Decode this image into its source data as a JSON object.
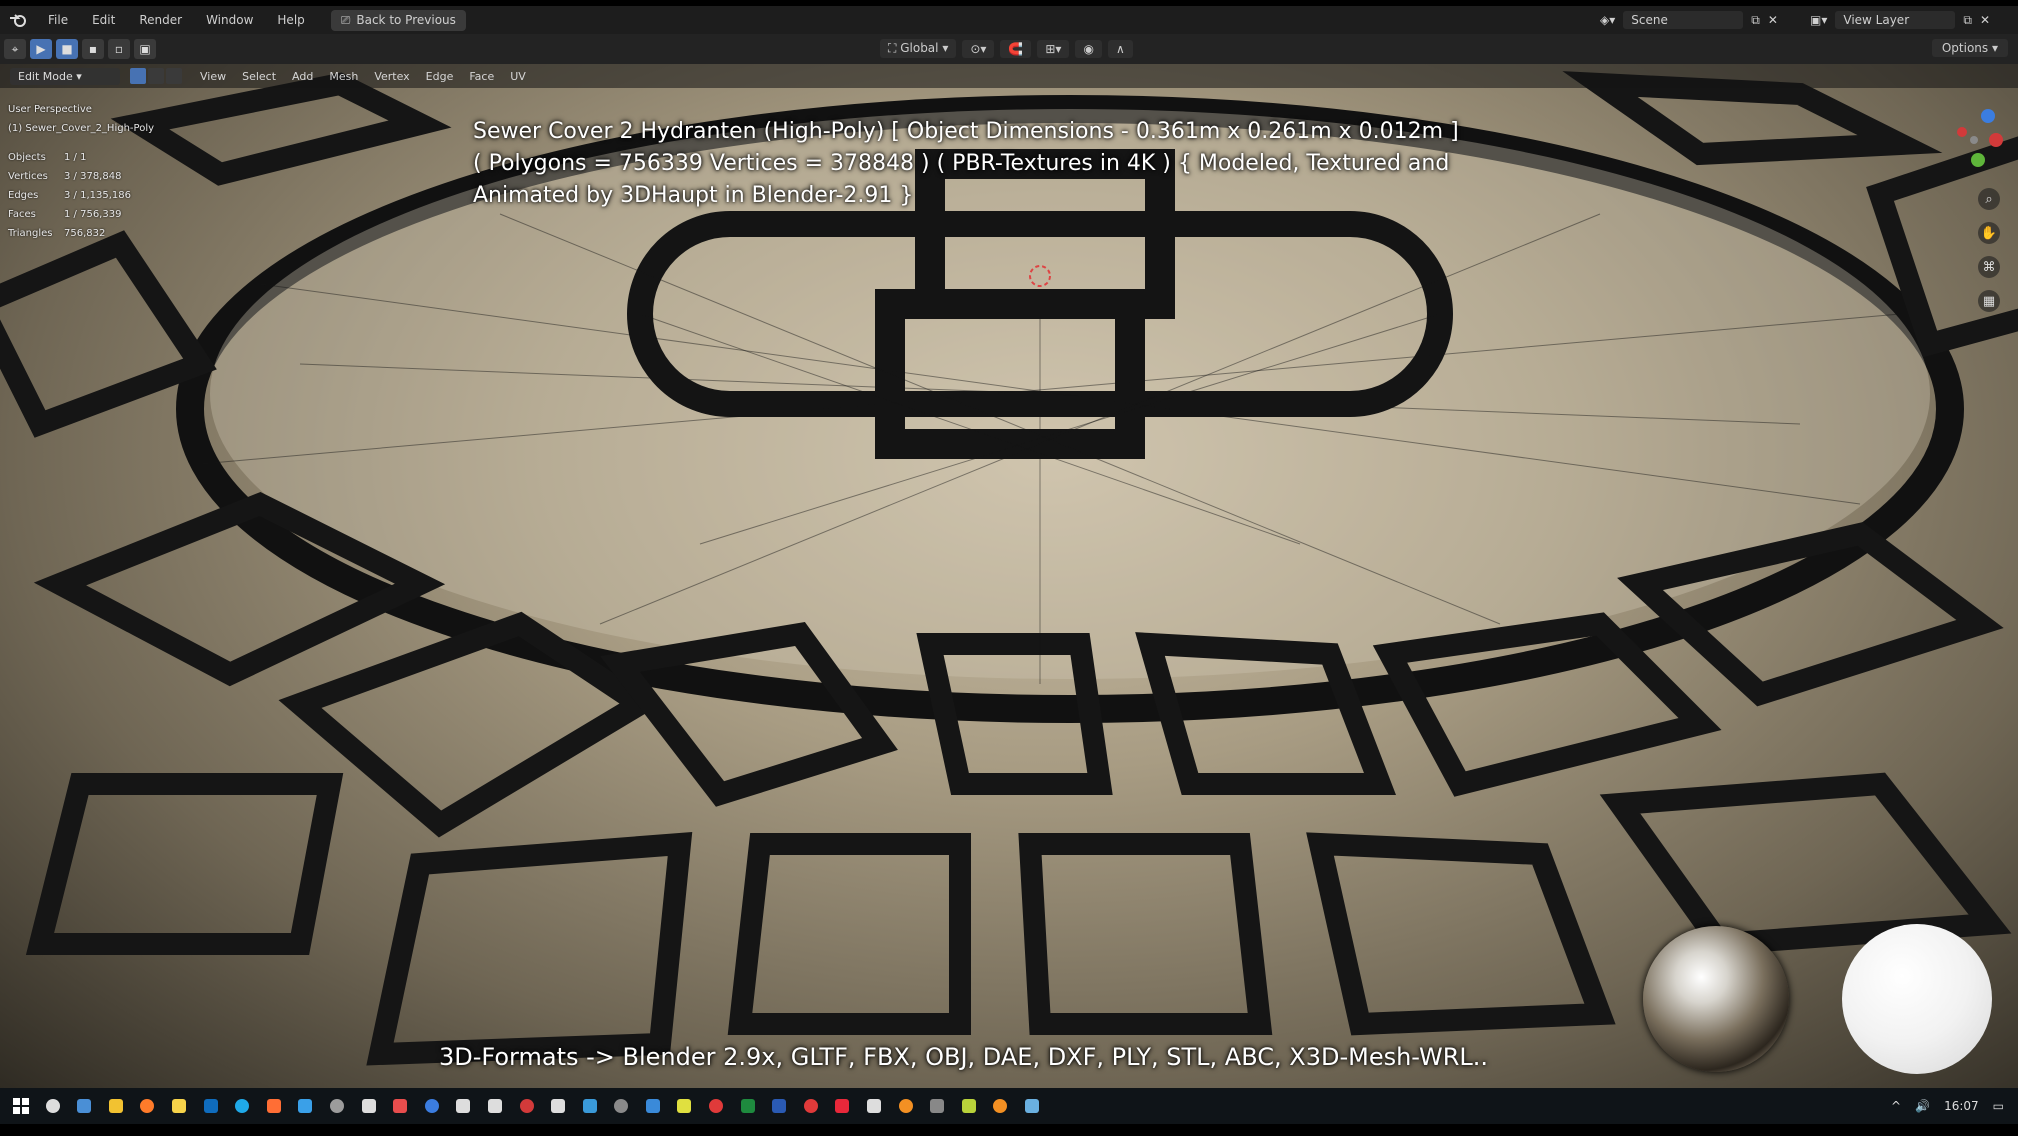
{
  "app": {
    "top_menu": [
      "File",
      "Edit",
      "Render",
      "Window",
      "Help"
    ],
    "back_button": "Back to Previous",
    "scene_name": "Scene",
    "view_layer": "View Layer"
  },
  "toolbar": {
    "transform_orientation": "Global",
    "options_label": "Options"
  },
  "viewport_header": {
    "mode": "Edit Mode",
    "menus": [
      "View",
      "Select",
      "Add",
      "Mesh",
      "Vertex",
      "Edge",
      "Face",
      "UV"
    ]
  },
  "stats": {
    "perspective": "User Perspective",
    "object_name": "(1) Sewer_Cover_2_High-Poly",
    "rows": [
      {
        "label": "Objects",
        "value": "1 / 1"
      },
      {
        "label": "Vertices",
        "value": "3 / 378,848"
      },
      {
        "label": "Edges",
        "value": "3 / 1,135,186"
      },
      {
        "label": "Faces",
        "value": "1 / 756,339"
      },
      {
        "label": "Triangles",
        "value": "756,832"
      }
    ]
  },
  "overlay": {
    "title_line1": "Sewer Cover 2 Hydranten (High-Poly) [ Object Dimensions -  0.361m x 0.261m x 0.012m ]",
    "title_line2": "( Polygons = 756339 Vertices = 378848 ) ( PBR-Textures in 4K ) { Modeled, Textured and",
    "title_line3": "Animated by 3DHaupt in Blender-2.91 }",
    "formats": "3D-Formats -> Blender 2.9x, GLTF, FBX, OBJ, DAE, DXF, PLY, STL, ABC, X3D-Mesh-WRL.."
  },
  "nav_icons": [
    "zoom-icon",
    "hand-pan-icon",
    "camera-icon",
    "grid-icon"
  ],
  "taskbar": {
    "icons": [
      "search-icon",
      "save-icon",
      "folder-icon",
      "firefox-icon",
      "notepad-icon",
      "outlook-icon",
      "skype-icon",
      "chrome-icon",
      "app-icon",
      "tool-icon",
      "unity-icon",
      "paint-icon",
      "sketch-icon",
      "inkscape-icon",
      "gem-icon",
      "record-icon",
      "obs-icon",
      "camera-icon",
      "calc-icon",
      "grid-app-icon",
      "color-icon",
      "star-icon",
      "excel-icon",
      "word-icon",
      "bug-icon",
      "opera-icon",
      "file-icon",
      "blender-icon",
      "terminal-icon",
      "plus-icon",
      "blender-icon-2",
      "editor-icon"
    ],
    "clock": "16:07"
  }
}
